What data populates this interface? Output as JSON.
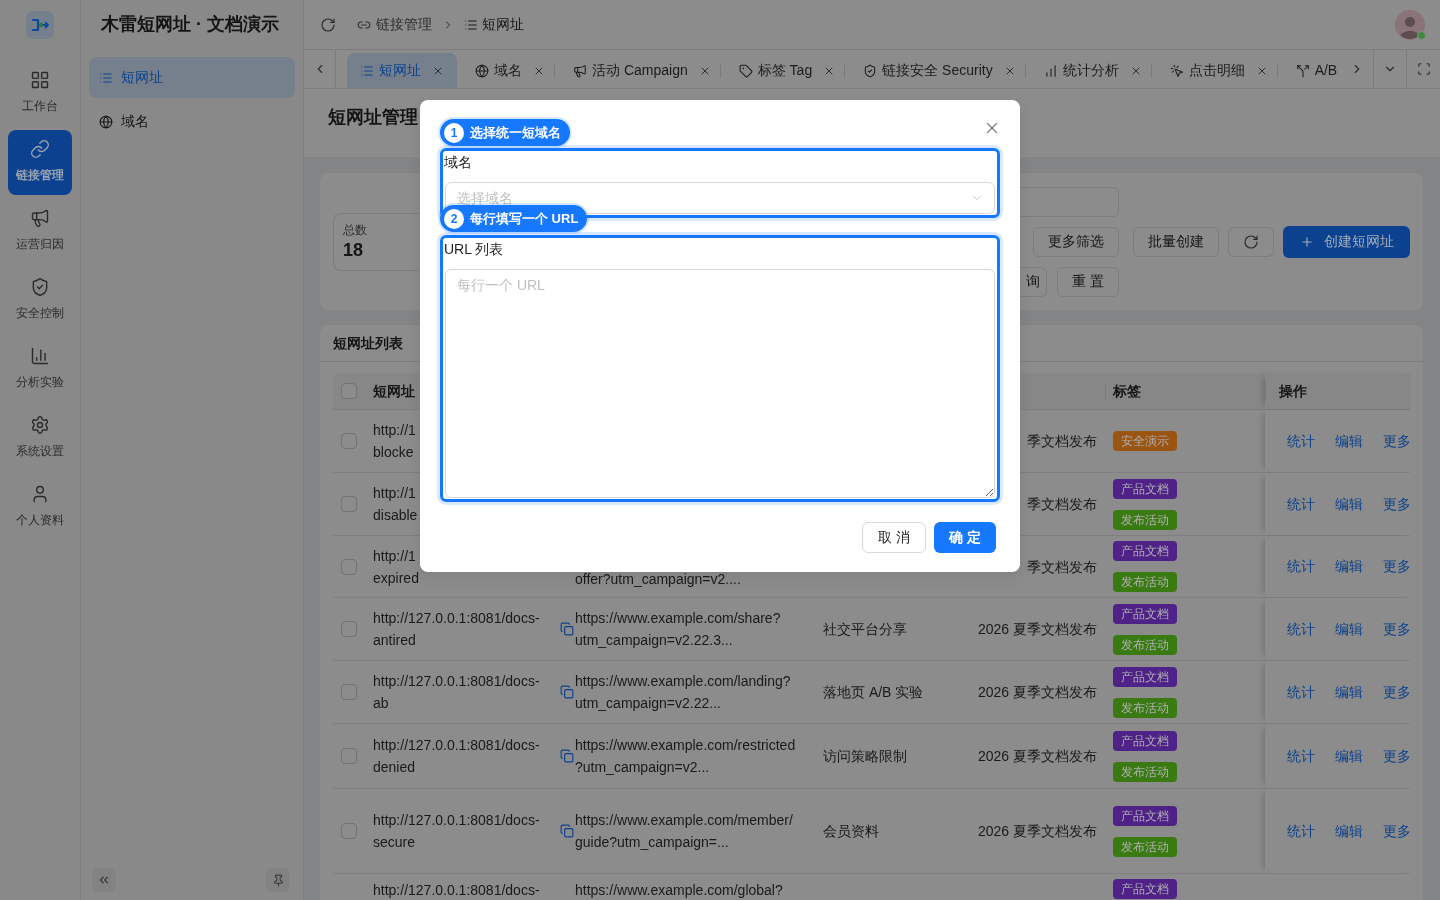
{
  "app": {
    "title": "木雷短网址 · 文档演示"
  },
  "rail": [
    {
      "label": "工作台",
      "selected": false
    },
    {
      "label": "链接管理",
      "selected": true
    },
    {
      "label": "运营归因",
      "selected": false
    },
    {
      "label": "安全控制",
      "selected": false
    },
    {
      "label": "分析实验",
      "selected": false
    },
    {
      "label": "系统设置",
      "selected": false
    },
    {
      "label": "个人资料",
      "selected": false
    }
  ],
  "menu": [
    {
      "label": "短网址",
      "selected": true
    },
    {
      "label": "域名",
      "selected": false
    }
  ],
  "breadcrumb": [
    "链接管理",
    "短网址"
  ],
  "tabs": [
    {
      "label": "短网址",
      "selected": true
    },
    {
      "label": "域名",
      "selected": false
    },
    {
      "label": "活动 Campaign",
      "selected": false
    },
    {
      "label": "标签 Tag",
      "selected": false
    },
    {
      "label": "链接安全 Security",
      "selected": false
    },
    {
      "label": "统计分析",
      "selected": false
    },
    {
      "label": "点击明细",
      "selected": false
    },
    {
      "label": "A/B",
      "selected": false
    }
  ],
  "page_title": "短网址管理",
  "summary": {
    "label": "总数",
    "value": "18"
  },
  "filters": {
    "more_filters": "更多筛选",
    "buttons": [
      "询",
      "重 置"
    ]
  },
  "actions": [
    {
      "kind": "default",
      "label": "批量创建"
    },
    {
      "kind": "refresh"
    },
    {
      "kind": "primary",
      "label": "创建短网址"
    }
  ],
  "table": {
    "title": "短网址列表",
    "header_checked": false,
    "columns": {
      "short_url": "短网址",
      "tags": "标签",
      "actions": "操作"
    },
    "rows": [
      {
        "checked": false,
        "short_url": "http://1\nblocke",
        "column_4": "季文档发布",
        "tags": [
          {
            "label": "安全演示",
            "color": "#9a5512"
          }
        ],
        "actions": [
          "统计",
          "编辑",
          "更多"
        ]
      },
      {
        "checked": false,
        "short_url": "http://1\ndisable",
        "column_4": "季文档发布",
        "tags": [
          {
            "label": "产品文档",
            "color": "#4f2288"
          },
          {
            "label": "发布活动",
            "color": "#3a7a12"
          }
        ],
        "actions": [
          "统计",
          "编辑",
          "更多"
        ]
      },
      {
        "checked": false,
        "short_url": "http://1\nexpired",
        "column_2": "offer?utm_campaign=v2....",
        "column_4": "季文档发布",
        "tags": [
          {
            "label": "产品文档",
            "color": "#4f2288"
          },
          {
            "label": "发布活动",
            "color": "#3a7a12"
          }
        ],
        "actions": [
          "统计",
          "编辑",
          "更多"
        ]
      },
      {
        "checked": false,
        "short_url": "http://127.0.0.1:8081/docs-antired",
        "column_2": "https://www.example.com/share?\nutm_campaign=v2.22.3...",
        "column_3": "社交平台分享",
        "column_4": "2026 夏季文档发布",
        "tags": [
          {
            "label": "产品文档",
            "color": "#4f2288"
          },
          {
            "label": "发布活动",
            "color": "#3a7a12"
          }
        ],
        "actions": [
          "统计",
          "编辑",
          "更多"
        ]
      },
      {
        "checked": false,
        "short_url": "http://127.0.0.1:8081/docs-ab",
        "column_2": "https://www.example.com/landing?\nutm_campaign=v2.22...",
        "column_3": "落地页 A/B 实验",
        "column_4": "2026 夏季文档发布",
        "tags": [
          {
            "label": "产品文档",
            "color": "#4f2288"
          },
          {
            "label": "发布活动",
            "color": "#3a7a12"
          }
        ],
        "actions": [
          "统计",
          "编辑",
          "更多"
        ]
      },
      {
        "checked": false,
        "short_url": "http://127.0.0.1:8081/docs-denied",
        "column_2": "https://www.example.com/restricted\n?utm_campaign=v2...",
        "column_3": "访问策略限制",
        "column_4": "2026 夏季文档发布",
        "tags": [
          {
            "label": "产品文档",
            "color": "#4f2288"
          },
          {
            "label": "发布活动",
            "color": "#3a7a12"
          }
        ],
        "actions": [
          "统计",
          "编辑",
          "更多"
        ]
      },
      {
        "checked": false,
        "short_url": "http://127.0.0.1:8081/docs-secure",
        "column_2": "https://www.example.com/member/\nguide?utm_campaign=...",
        "column_3": "会员资料",
        "column_4": "2026 夏季文档发布",
        "tags": [
          {
            "label": "产品文档",
            "color": "#4f2288"
          },
          {
            "label": "发布活动",
            "color": "#3a7a12"
          }
        ],
        "actions": [
          "统计",
          "编辑",
          "更多"
        ]
      },
      {
        "short_url": "http://127.0.0.1:8081/docs-",
        "column_2": "https://www.example.com/global?",
        "tags": [
          {
            "label": "产品文档",
            "color": "#4f2288"
          }
        ]
      }
    ]
  },
  "dialog": {
    "steps": [
      {
        "number": "1",
        "label": "选择统一短域名"
      },
      {
        "number": "2",
        "label": "每行填写一个 URL"
      }
    ],
    "fields": [
      {
        "kind": "select",
        "label": "域名",
        "placeholder": "选择域名"
      },
      {
        "kind": "textarea",
        "label": "URL 列表",
        "placeholder": "每行一个 URL"
      }
    ],
    "buttons": [
      {
        "kind": "default",
        "label": "取 消"
      },
      {
        "kind": "primary",
        "label": "确 定"
      }
    ]
  }
}
